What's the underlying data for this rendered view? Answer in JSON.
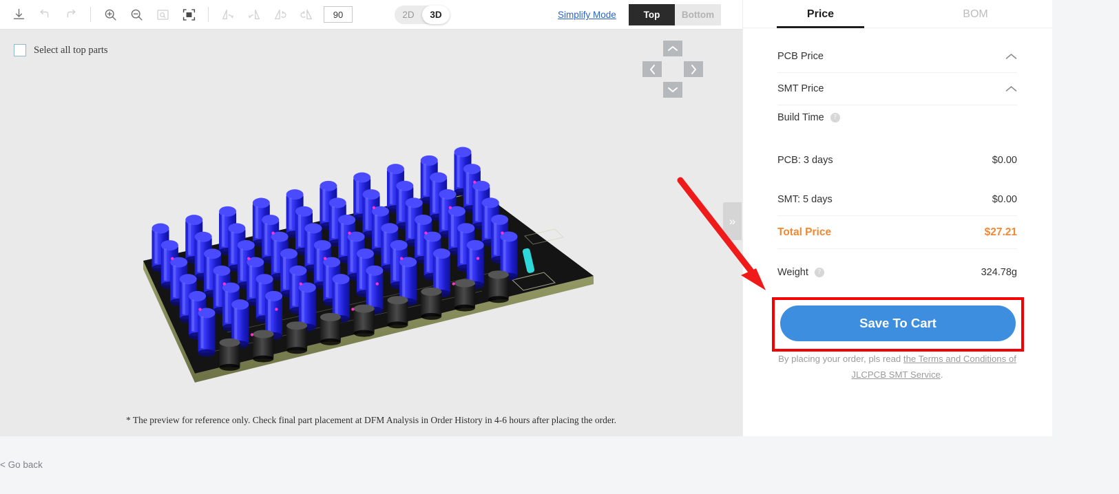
{
  "toolbar": {
    "tools": [
      {
        "name": "download-icon",
        "label": "Download",
        "disabled": false
      },
      {
        "name": "undo-icon",
        "label": "Undo",
        "disabled": true
      },
      {
        "name": "redo-icon",
        "label": "Redo",
        "disabled": true
      },
      {
        "name": "zoom-in-icon",
        "label": "Zoom In",
        "disabled": false
      },
      {
        "name": "zoom-out-icon",
        "label": "Zoom Out",
        "disabled": false
      },
      {
        "name": "zoom-region-icon",
        "label": "Zoom Region",
        "disabled": true
      },
      {
        "name": "fit-screen-icon",
        "label": "Fit To Screen",
        "disabled": false
      },
      {
        "name": "flip-horizontal-icon",
        "label": "Flip Horizontal",
        "disabled": true
      },
      {
        "name": "flip-vertical-icon",
        "label": "Flip Vertical",
        "disabled": true
      },
      {
        "name": "rotate-cw-icon",
        "label": "Rotate Clockwise",
        "disabled": true
      },
      {
        "name": "rotate-ccw-icon",
        "label": "Rotate Counter-clockwise",
        "disabled": true
      }
    ],
    "rotation_value": "90",
    "dimension": {
      "options": [
        "2D",
        "3D"
      ],
      "selected": "3D"
    },
    "simplify_mode": "Simplify Mode",
    "side": {
      "options": [
        "Top",
        "Bottom"
      ],
      "selected": "Top"
    }
  },
  "viewport": {
    "select_all_label": "Select all top parts",
    "select_all_checked": false,
    "nav": {
      "up": "▲",
      "down": "▼",
      "left": "◀",
      "right": "▶"
    },
    "collapse_handle": "»",
    "footnote": "* The preview for reference only. Check final part placement at DFM Analysis in Order History in 4-6 hours after placing the order."
  },
  "panel": {
    "tabs": [
      {
        "label": "Price",
        "active": true
      },
      {
        "label": "BOM",
        "active": false
      }
    ],
    "accordions": [
      {
        "label": "PCB Price",
        "expanded": true,
        "chevron": "⌃"
      },
      {
        "label": "SMT Price",
        "expanded": true,
        "chevron": "⌃"
      }
    ],
    "build_time_label": "Build Time",
    "help_glyph": "?",
    "rows": [
      {
        "label": "PCB: 3 days",
        "value": "$0.00"
      },
      {
        "label": "SMT: 5 days",
        "value": "$0.00"
      },
      {
        "label": "Total Price",
        "value": "$27.21",
        "highlight": true
      },
      {
        "label": "Weight",
        "value": "324.78g",
        "has_help": true
      }
    ],
    "cta_label": "Save To Cart",
    "terms_prefix": "By placing your order, pls read ",
    "terms_link": "the Terms and Conditions of JLCPCB SMT Service",
    "terms_suffix": "."
  },
  "bottom": {
    "go_back": "< Go back"
  },
  "colors": {
    "accent_blue": "#3d8ede",
    "total_orange": "#f08834",
    "highlight_red": "#f40000",
    "link_blue": "#2a63c4",
    "viewport_bg": "#eaeaea",
    "pcb_green": "#1a1a1a",
    "cap_blue": "#1f20e0"
  }
}
